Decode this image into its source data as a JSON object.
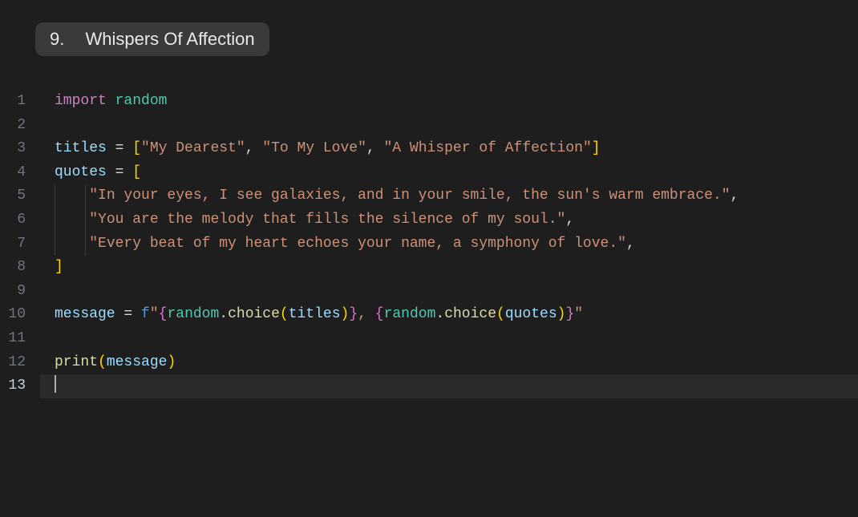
{
  "header": {
    "number": "9.",
    "title": "Whispers Of Affection"
  },
  "code": {
    "keyword_import": "import",
    "module_random": "random",
    "var_titles": "titles",
    "var_quotes": "quotes",
    "var_message": "message",
    "op_eq": " = ",
    "brack_open": "[",
    "brack_close": "]",
    "brack2_open": "[",
    "brack2_close": "]",
    "paren_open": "(",
    "paren_close": ")",
    "brace_open": "{",
    "brace_close": "}",
    "comma": ",",
    "comma_sp": ", ",
    "dot": ".",
    "title1": "\"My Dearest\"",
    "title2": "\"To My Love\"",
    "title3": "\"A Whisper of Affection\"",
    "quote1": "\"In your eyes, I see galaxies, and in your smile, the sun's warm embrace.\"",
    "quote2": "\"You are the melody that fills the silence of my soul.\"",
    "quote3": "\"Every beat of my heart echoes your name, a symphony of love.\"",
    "f_prefix": "f",
    "fq": "\"",
    "fstr_sep": ", ",
    "func_choice": "choice",
    "func_print": "print",
    "module_random2": "random",
    "line_numbers": [
      "1",
      "2",
      "3",
      "4",
      "5",
      "6",
      "7",
      "8",
      "9",
      "10",
      "11",
      "12",
      "13"
    ]
  }
}
